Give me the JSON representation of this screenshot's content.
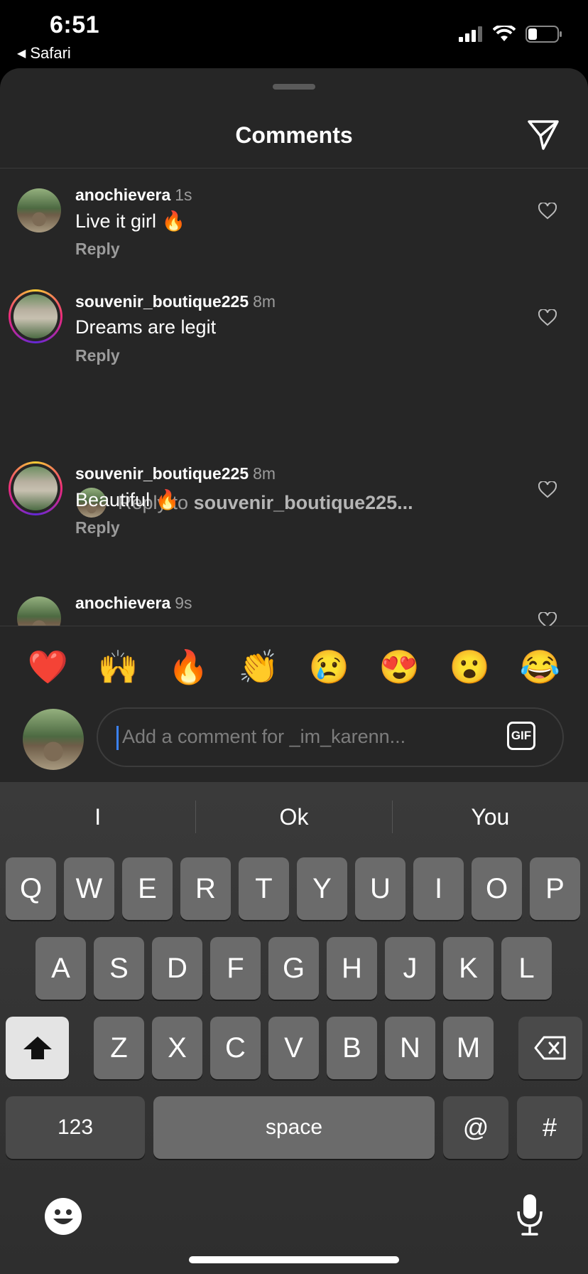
{
  "status_bar": {
    "time": "6:51",
    "back_app": "Safari"
  },
  "sheet": {
    "title": "Comments"
  },
  "comments": [
    {
      "username": "anochievera",
      "time": "1s",
      "text": "Live it girl 🔥",
      "reply_label": "Reply"
    },
    {
      "username": "souvenir_boutique225",
      "time": "8m",
      "text": "Dreams are legit",
      "reply_label": "Reply"
    },
    {
      "username": "souvenir_boutique225",
      "time": "8m",
      "text": "Beautiful 🔥",
      "reply_label": "Reply"
    },
    {
      "username": "anochievera",
      "time": "9s",
      "text": "",
      "reply_label": ""
    }
  ],
  "reply_prompt": {
    "prefix": "Reply to",
    "target": "souvenir_boutique225..."
  },
  "emoji_bar": [
    "❤️",
    "🙌",
    "🔥",
    "👏",
    "😢",
    "😍",
    "😮",
    "😂"
  ],
  "composer": {
    "placeholder": "Add a comment for _im_karenn...",
    "gif_label": "GIF"
  },
  "keyboard": {
    "suggestions": [
      "I",
      "Ok",
      "You"
    ],
    "row1": [
      "Q",
      "W",
      "E",
      "R",
      "T",
      "Y",
      "U",
      "I",
      "O",
      "P"
    ],
    "row2": [
      "A",
      "S",
      "D",
      "F",
      "G",
      "H",
      "J",
      "K",
      "L"
    ],
    "row3": [
      "Z",
      "X",
      "C",
      "V",
      "B",
      "N",
      "M"
    ],
    "numbers_label": "123",
    "space_label": "space",
    "at_label": "@",
    "hash_label": "#"
  }
}
